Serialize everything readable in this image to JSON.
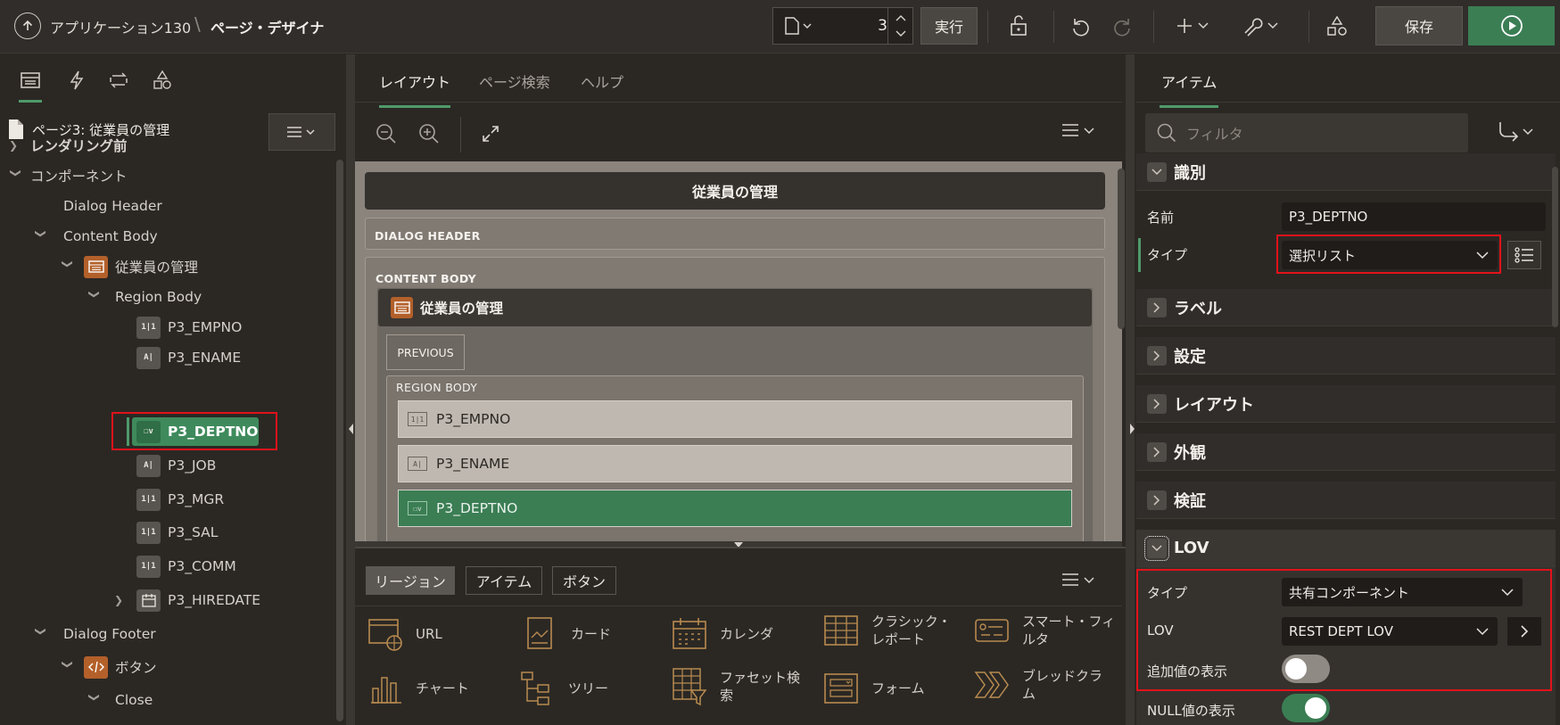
{
  "header": {
    "app_name": "アプリケーション130",
    "separator": "\\",
    "page_name": "ページ・デザイナ",
    "page_number": "3",
    "run_label": "実行",
    "save_label": "保存"
  },
  "left": {
    "page_title": "ページ3: 従業員の管理",
    "tree": {
      "pre_rendering": "レンダリング前",
      "components": "コンポーネント",
      "dialog_header": "Dialog Header",
      "content_body": "Content Body",
      "region": "従業員の管理",
      "region_body": "Region Body",
      "items": [
        "P3_EMPNO",
        "P3_ENAME",
        "P3_DEPTNO",
        "P3_JOB",
        "P3_MGR",
        "P3_SAL",
        "P3_COMM",
        "P3_HIREDATE"
      ],
      "dialog_footer": "Dialog Footer",
      "buttons": "ボタン",
      "close": "Close"
    }
  },
  "center": {
    "tabs": [
      "レイアウト",
      "ページ検索",
      "ヘルプ"
    ],
    "canvas": {
      "title": "従業員の管理",
      "dialog_header": "DIALOG HEADER",
      "content_body": "CONTENT BODY",
      "region": "従業員の管理",
      "previous": "PREVIOUS",
      "region_body": "REGION BODY",
      "items": [
        "P3_EMPNO",
        "P3_ENAME",
        "P3_DEPTNO"
      ]
    },
    "gallery": {
      "tabs": [
        "リージョン",
        "アイテム",
        "ボタン"
      ],
      "cells": [
        "URL",
        "カード",
        "カレンダ",
        "クラシック・\nレポート",
        "スマート・フィ\nルタ",
        "チャート",
        "ツリー",
        "ファセット検\n索",
        "フォーム",
        "ブレッドクラ\nム"
      ]
    }
  },
  "right": {
    "tab": "アイテム",
    "filter_placeholder": "フィルタ",
    "sections": {
      "identification": "識別",
      "label": "ラベル",
      "settings": "設定",
      "layout": "レイアウト",
      "appearance": "外観",
      "validation": "検証",
      "lov": "LOV"
    },
    "name_label": "名前",
    "name_value": "P3_DEPTNO",
    "type_label": "タイプ",
    "type_value": "選択リスト",
    "lov_type_label": "タイプ",
    "lov_type_value": "共有コンポーネント",
    "lov_label": "LOV",
    "lov_value": "REST DEPT LOV",
    "display_extra_label": "追加値の表示",
    "display_extra_on": false,
    "display_null_label": "NULL値の表示",
    "display_null_on": true
  },
  "colors": {
    "accent_green": "#3b7e54",
    "highlight_red": "#e2121a",
    "region_orange": "#b3602a"
  }
}
